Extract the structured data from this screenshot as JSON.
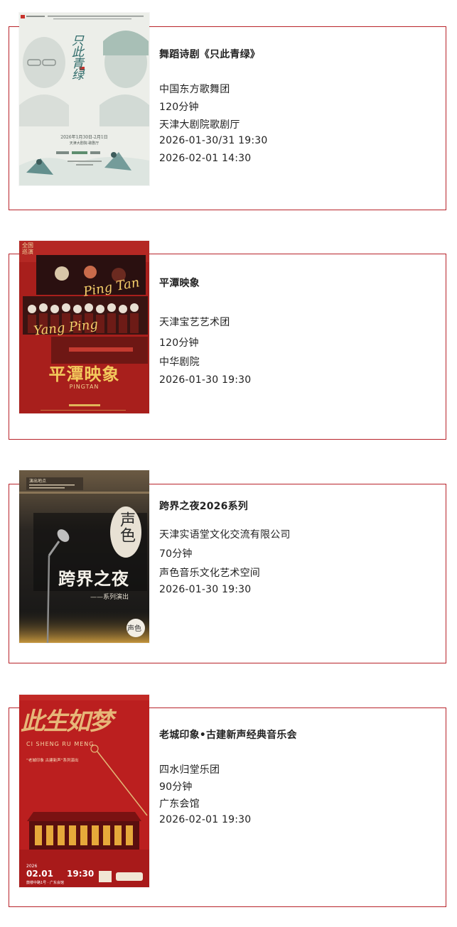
{
  "events": [
    {
      "title": "舞蹈诗剧《只此青绿》",
      "company": "中国东方歌舞团",
      "duration": "120分钟",
      "venue": "天津大剧院歌剧厅",
      "times": [
        "2026-01-30/31 19:30",
        "2026-02-01 14:30"
      ],
      "poster": {
        "title_art": "只此青绿",
        "date_line": "2026年1月30日-2月1日",
        "venue_line": "天津大剧院·歌剧厅"
      }
    },
    {
      "title": "平潭映象",
      "company": "天津宝艺艺术团",
      "duration": "120分钟",
      "venue": "中华剧院",
      "times": [
        "2026-01-30 19:30"
      ],
      "poster": {
        "corner_text": "全国巡演",
        "overlay_1": "Ping Tan",
        "overlay_2": "Yang Ping",
        "title_art": "平潭映象",
        "subtitle": "PINGTAN"
      }
    },
    {
      "title": "跨界之夜2026系列",
      "company": "天津实语堂文化交流有限公司",
      "duration": "70分钟",
      "venue": "声色音乐文化艺术空间",
      "times": [
        "2026-01-30 19:30"
      ],
      "poster": {
        "tag": "演出地点",
        "logo_text": "声色",
        "title_art": "跨界之夜",
        "subtitle": "——系列演出",
        "badge": "声色"
      }
    },
    {
      "title": "老城印象•古建新声经典音乐会",
      "company": "四水归堂乐团",
      "duration": "90分钟",
      "venue": "广东会馆",
      "times": [
        "2026-02-01 19:30"
      ],
      "poster": {
        "title_art": "此生如梦",
        "pinyin": "CI SHENG RU MENG",
        "series": "“老城印象 古建新声”系列演出",
        "year": "2026",
        "date": "02.01",
        "time": "19:30",
        "venue_line": "鼓楼中路1号 · 广东会馆"
      }
    }
  ]
}
